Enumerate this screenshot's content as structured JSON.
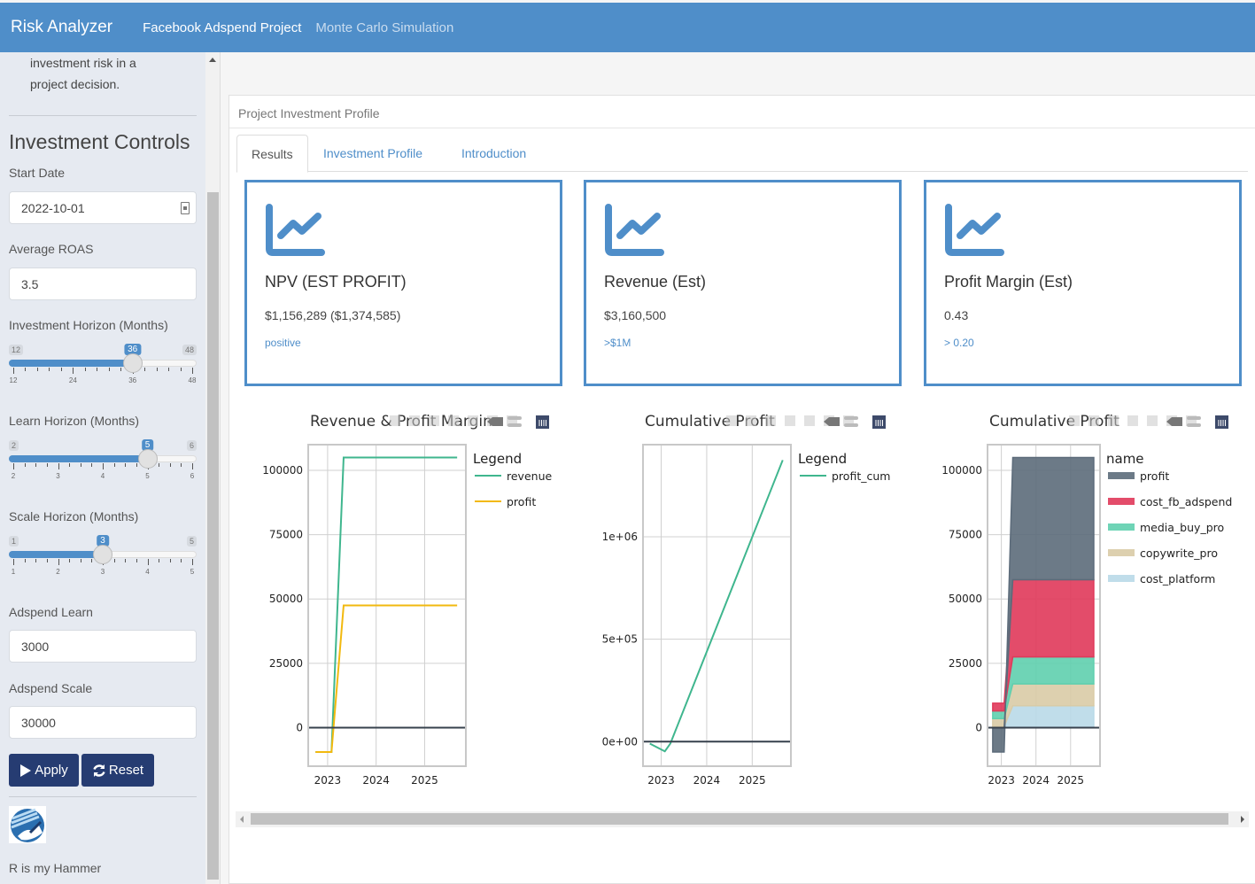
{
  "navbar": {
    "brand": "Risk Analyzer",
    "links": [
      {
        "label": "Facebook Adspend Project",
        "active": true
      },
      {
        "label": "Monte Carlo Simulation",
        "active": false
      }
    ]
  },
  "sidebar": {
    "intro_line1": "investment risk in a",
    "intro_line2": "project decision.",
    "controls_title": "Investment Controls",
    "start_date": {
      "label": "Start Date",
      "value": "2022-10-01"
    },
    "roas": {
      "label": "Average ROAS",
      "value": "3.5"
    },
    "sliders": [
      {
        "label": "Investment Horizon (Months)",
        "min": 12,
        "max": 48,
        "value": 36,
        "ticks": [
          "12",
          "24",
          "36",
          "48"
        ],
        "minor_per_major": 5
      },
      {
        "label": "Learn Horizon (Months)",
        "min": 2,
        "max": 6,
        "value": 5,
        "ticks": [
          "2",
          "3",
          "4",
          "5",
          "6"
        ],
        "minor_per_major": 4
      },
      {
        "label": "Scale Horizon (Months)",
        "min": 1,
        "max": 5,
        "value": 3,
        "ticks": [
          "1",
          "2",
          "3",
          "4",
          "5"
        ],
        "minor_per_major": 4
      }
    ],
    "adspend_learn": {
      "label": "Adspend Learn",
      "value": "3000"
    },
    "adspend_scale": {
      "label": "Adspend Scale",
      "value": "30000"
    },
    "apply_label": "Apply",
    "reset_label": "Reset",
    "footer_text": "R is my Hammer"
  },
  "main": {
    "panel_title": "Project Investment Profile",
    "tabs": [
      {
        "label": "Results",
        "active": true
      },
      {
        "label": "Investment Profile",
        "active": false
      },
      {
        "label": "Introduction",
        "active": false
      }
    ],
    "value_boxes": [
      {
        "title": "NPV (EST PROFIT)",
        "value": "$1,156,289 ($1,374,585)",
        "subtitle": "positive"
      },
      {
        "title": "Revenue (Est)",
        "value": "$3,160,500",
        "subtitle": ">$1M"
      },
      {
        "title": "Profit Margin (Est)",
        "value": "0.43",
        "subtitle": "> 0.20"
      }
    ]
  },
  "chart_data": [
    {
      "type": "line",
      "title": "Revenue & Profit Margin",
      "legend_title": "Legend",
      "legend_position": "right",
      "xlabel": "",
      "ylabel": "",
      "x_ticks": [
        "2023",
        "2024",
        "2025"
      ],
      "y_ticks": [
        "0",
        "25000",
        "50000",
        "75000",
        "100000"
      ],
      "ylim": [
        -15000,
        110000
      ],
      "xlim": [
        2022.6,
        2025.85
      ],
      "x": [
        2022.75,
        2023.08,
        2023.33,
        2025.67
      ],
      "series": [
        {
          "name": "revenue",
          "color": "#3fb68e",
          "values": [
            -9500,
            -9500,
            105000,
            105000
          ]
        },
        {
          "name": "profit",
          "color": "#f2b90f",
          "values": [
            -9500,
            -9500,
            47500,
            47500
          ]
        }
      ],
      "grid": true
    },
    {
      "type": "line",
      "title": "Cumulative Profit",
      "legend_title": "Legend",
      "legend_position": "right",
      "xlabel": "",
      "ylabel": "",
      "x_ticks": [
        "2023",
        "2024",
        "2025"
      ],
      "y_ticks": [
        "0e+00",
        "5e+05",
        "1e+06"
      ],
      "ylim": [
        -120000,
        1450000
      ],
      "xlim": [
        2022.6,
        2025.85
      ],
      "x": [
        2022.75,
        2023.08,
        2023.2,
        2025.67
      ],
      "series": [
        {
          "name": "profit_cum",
          "color": "#3fb68e",
          "values": [
            -9500,
            -47500,
            -10000,
            1374585
          ]
        }
      ],
      "grid": true
    },
    {
      "type": "area",
      "title": "Cumulative Profit",
      "legend_title": "name",
      "legend_position": "right",
      "xlabel": "",
      "ylabel": "",
      "x_ticks": [
        "2023",
        "2024",
        "2025"
      ],
      "y_ticks": [
        "0",
        "25000",
        "50000",
        "75000",
        "100000"
      ],
      "ylim": [
        -15000,
        110000
      ],
      "xlim": [
        2022.6,
        2025.85
      ],
      "x": [
        2022.75,
        2023.08,
        2023.33,
        2025.67
      ],
      "series": [
        {
          "name": "profit",
          "color": "#5c6b7a",
          "values": [
            -9500,
            -9500,
            47500,
            47500
          ]
        },
        {
          "name": "cost_fb_adspend",
          "color": "#e0395a",
          "values": [
            3000,
            3000,
            30000,
            30000
          ]
        },
        {
          "name": "media_buy_pro",
          "color": "#5fcfae",
          "values": [
            3000,
            3000,
            10500,
            10500
          ]
        },
        {
          "name": "copywrite_pro",
          "color": "#d9cba6",
          "values": [
            3000,
            3000,
            8500,
            8500
          ]
        },
        {
          "name": "cost_platform",
          "color": "#b9d9e8",
          "values": [
            500,
            500,
            8500,
            8500
          ]
        }
      ],
      "grid": true
    }
  ]
}
